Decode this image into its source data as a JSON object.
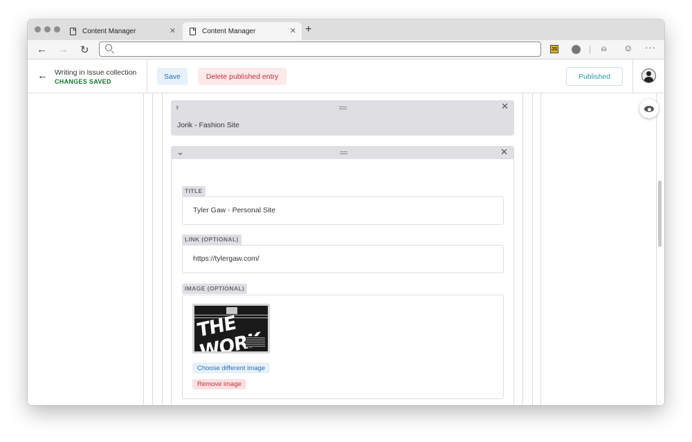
{
  "browser": {
    "tabs": [
      {
        "label": "Content Manager",
        "active": false
      },
      {
        "label": "Content Manager",
        "active": true
      }
    ],
    "address": {
      "value": "",
      "placeholder": ""
    },
    "icons": {
      "back": "back-arrow-icon",
      "forward": "forward-arrow-icon",
      "reload": "reload-icon",
      "search": "search-icon",
      "js_extension": "js-extension-icon",
      "ghostery": "ghostery-extension-icon",
      "profile": "profile-icon",
      "emoji": "emoji-icon",
      "more": "more-icon"
    },
    "js_badge": "JS"
  },
  "header": {
    "collection_label": "Writing in Issue collection",
    "status": "CHANGES SAVED",
    "save_label": "Save",
    "delete_label": "Delete published entry",
    "published_label": "Published"
  },
  "items": {
    "collapsed": {
      "name": "Jorik - Fashion Site"
    },
    "open": {
      "fields": [
        {
          "label": "TITLE",
          "value": "Tyler Gaw - Personal Site"
        },
        {
          "label": "LINK (OPTIONAL)",
          "value": "https://tylergaw.com/"
        },
        {
          "label": "IMAGE (OPTIONAL)"
        }
      ],
      "image": {
        "text": "THE WORK",
        "choose_label": "Choose different image",
        "remove_label": "Remove image"
      }
    }
  },
  "colors": {
    "status_green": "#0f7a2d",
    "save_blue": "#2a6fb5",
    "delete_red": "#c0303b",
    "published_teal": "#2c9aa7"
  }
}
